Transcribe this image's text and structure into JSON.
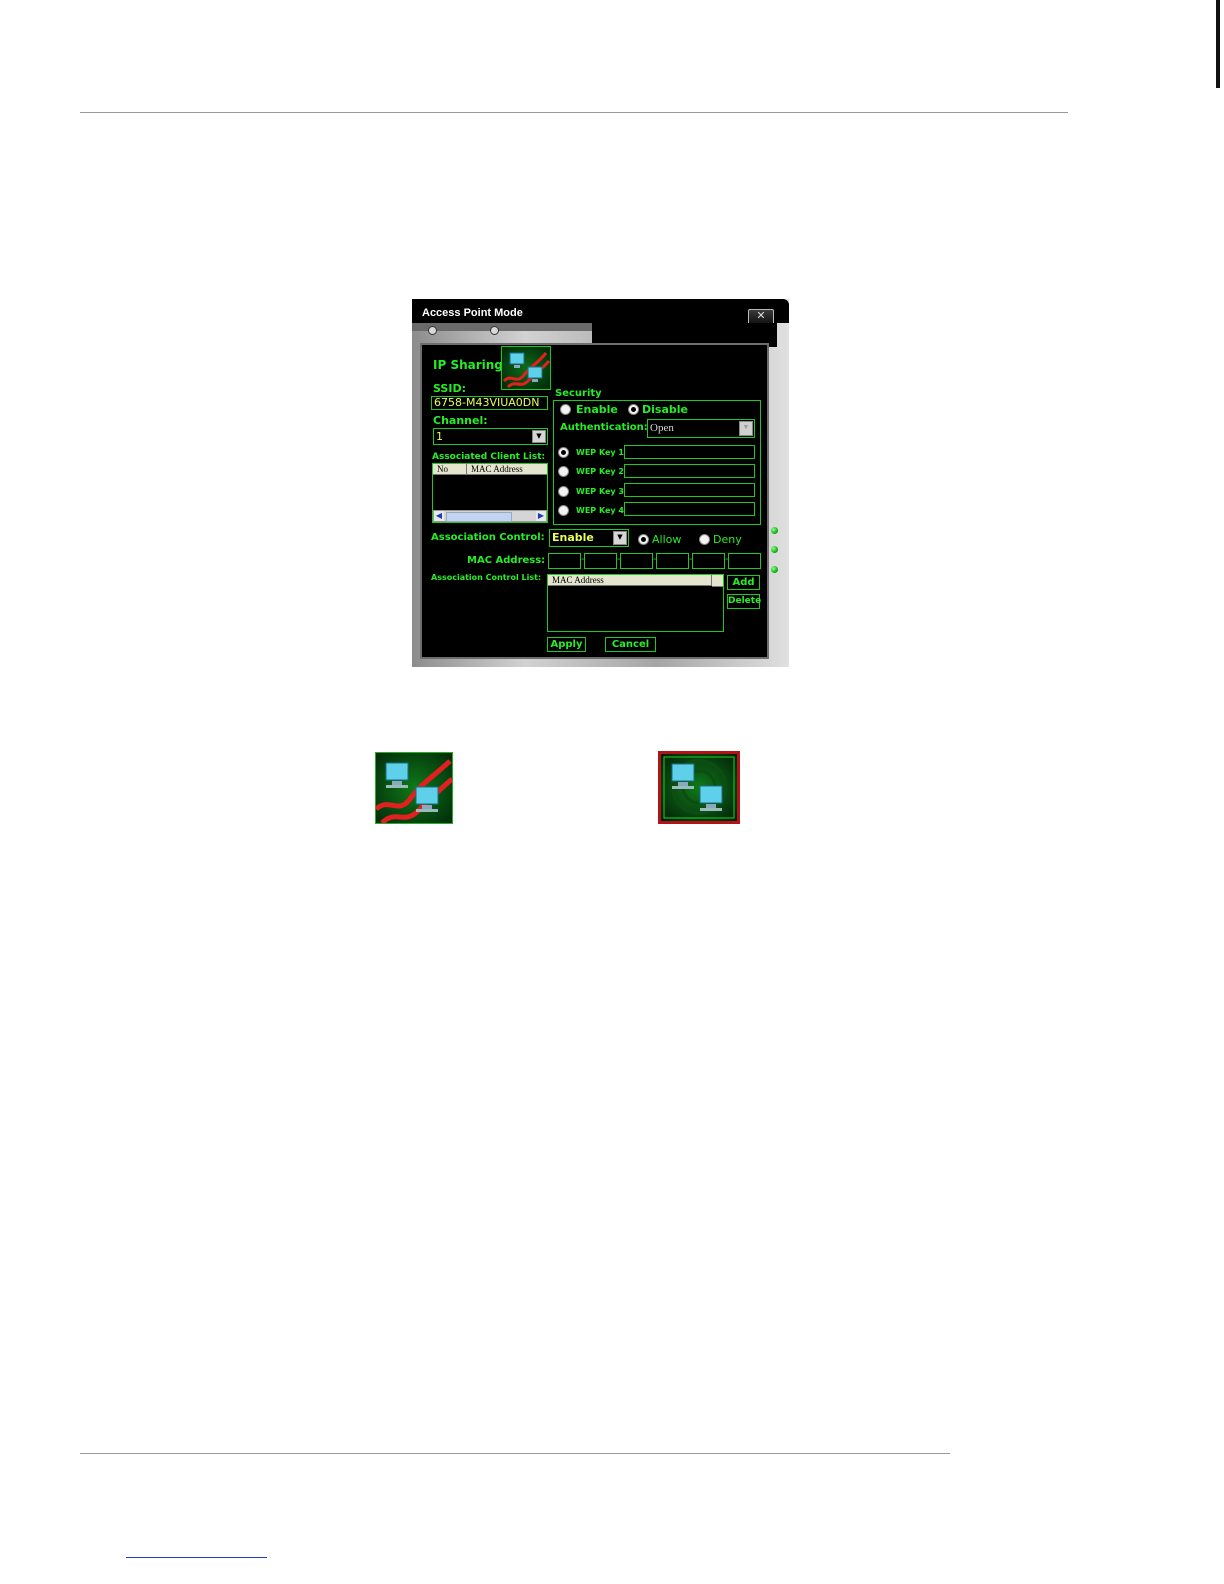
{
  "window": {
    "title": "Access Point Mode",
    "close_glyph": "✕"
  },
  "ip_sharing": {
    "label": "IP Sharing",
    "icon": "ip-sharing-icon"
  },
  "ssid": {
    "label": "SSID:",
    "value": "6758-M43VIUA0DN"
  },
  "channel": {
    "label": "Channel:",
    "value": "1"
  },
  "client_list": {
    "label": "Associated Client List:",
    "columns": [
      "No",
      "MAC Address"
    ]
  },
  "security": {
    "label": "Security",
    "enable_label": "Enable",
    "disable_label": "Disable",
    "selected": "Disable",
    "auth_label": "Authentication:",
    "auth_value": "Open",
    "wep_keys": [
      "WEP Key 1",
      "WEP Key 2",
      "WEP Key 3",
      "WEP Key 4"
    ],
    "selected_key": "WEP Key 1"
  },
  "association": {
    "label": "Association Control:",
    "value": "Enable",
    "allow_label": "Allow",
    "deny_label": "Deny",
    "selected": "Allow",
    "mac_label": "MAC Address:",
    "list_label": "Association Control List:",
    "list_column": "MAC Address",
    "add_label": "Add",
    "delete_label": "Delete"
  },
  "actions": {
    "apply_label": "Apply",
    "cancel_label": "Cancel"
  },
  "bottom_icons": [
    "ip-sharing-icon",
    "access-point-icon"
  ],
  "colors": {
    "accent_green": "#28ec28",
    "field_text": "#e8ff5a",
    "panel_bg": "#000000"
  }
}
